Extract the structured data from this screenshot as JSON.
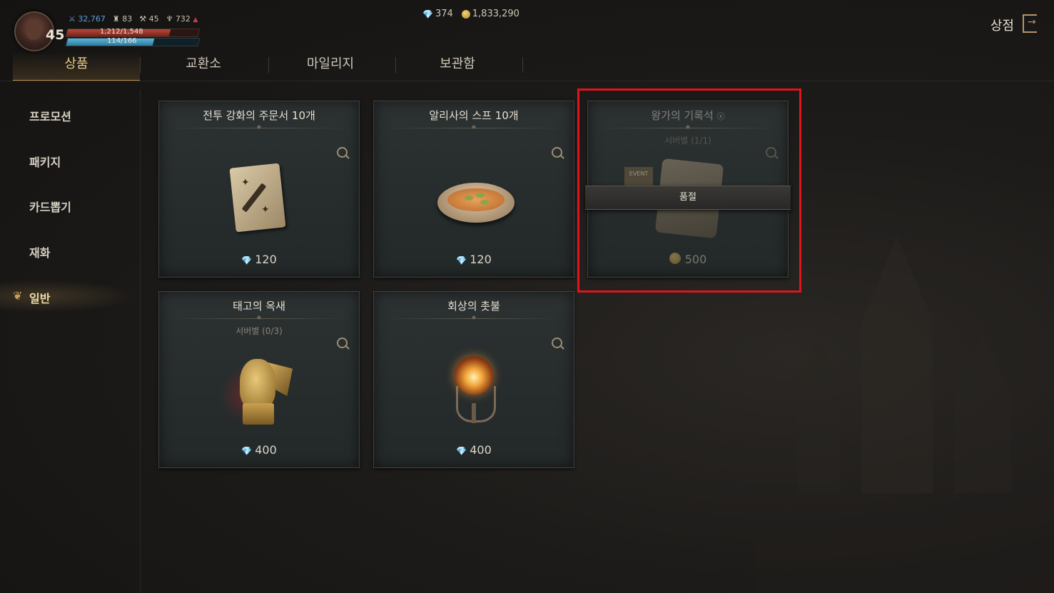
{
  "player": {
    "level": "45",
    "combat_power": "32,767",
    "stat_a": "83",
    "stat_b": "45",
    "stat_c": "732",
    "hp_text": "1,212/1,548",
    "mp_text": "114/166"
  },
  "currency": {
    "gems": "374",
    "gold": "1,833,290"
  },
  "header": {
    "title": "상점"
  },
  "tabs": [
    {
      "label": "상품"
    },
    {
      "label": "교환소"
    },
    {
      "label": "마일리지"
    },
    {
      "label": "보관함"
    }
  ],
  "sidebar": {
    "items": [
      {
        "label": "프로모션"
      },
      {
        "label": "패키지"
      },
      {
        "label": "카드뽑기"
      },
      {
        "label": "재화"
      },
      {
        "label": "일반"
      }
    ]
  },
  "products": [
    {
      "name": "전투 강화의 주문서 10개",
      "limit": "",
      "price": "120",
      "currency": "gem",
      "status": ""
    },
    {
      "name": "알리사의 스프 10개",
      "limit": "",
      "price": "120",
      "currency": "gem",
      "status": ""
    },
    {
      "name": "왕가의 기록석",
      "limit": "서버별 (1/1)",
      "price": "500",
      "currency": "gold",
      "status": "품절",
      "banner": "EVENT"
    },
    {
      "name": "태고의 옥새",
      "limit": "서버별 (0/3)",
      "price": "400",
      "currency": "gem",
      "status": ""
    },
    {
      "name": "회상의 촛불",
      "limit": "",
      "price": "400",
      "currency": "gem",
      "status": ""
    }
  ],
  "colors": {
    "accent_gold": "#e7c888",
    "highlight_red": "#e0141c",
    "hp": "#b34a3c",
    "mp": "#5cb6d8"
  }
}
